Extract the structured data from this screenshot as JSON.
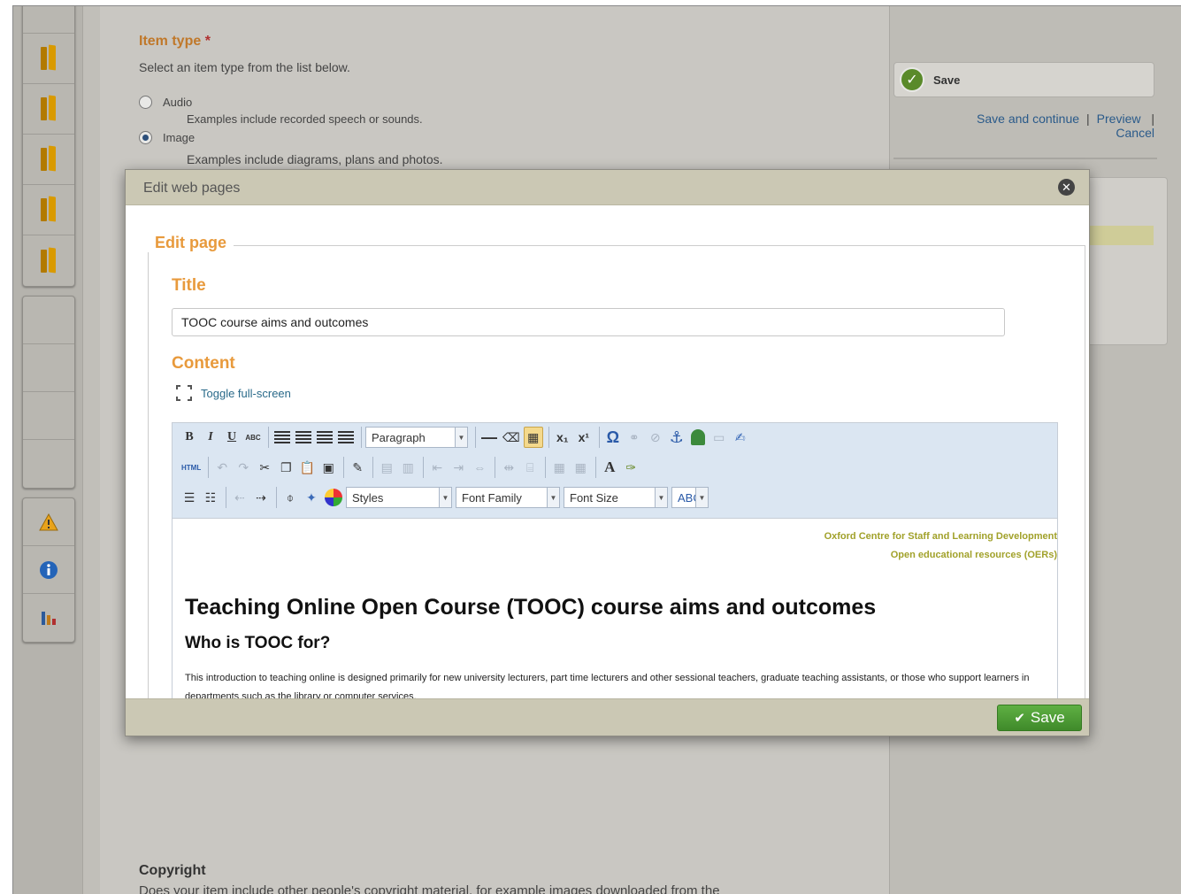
{
  "background": {
    "item_type_label": "Item type",
    "required_mark": "*",
    "item_type_hint": "Select an item type from the list below.",
    "options": [
      {
        "label": "Audio",
        "description": "Examples include recorded speech or sounds.",
        "checked": false
      },
      {
        "label": "Image",
        "description": "Examples include diagrams, plans and photos.",
        "checked": true
      }
    ],
    "copyright_label": "Copyright",
    "copyright_text": "Does your item include other people's copyright material, for example images downloaded from the"
  },
  "sidebar_icons": {
    "group1": [
      "book-icon",
      "book-icon",
      "book-icon",
      "book-icon",
      "book-icon"
    ],
    "group3": [
      "warning-icon",
      "info-icon",
      "chart-icon"
    ]
  },
  "right_panel": {
    "save_label": "Save",
    "save_and_continue": "Save and continue",
    "separator": "|",
    "preview": "Preview",
    "cancel": "Cancel"
  },
  "modal": {
    "title": "Edit web pages",
    "close_glyph": "✕",
    "legend": "Edit page",
    "title_label": "Title",
    "title_value": "TOOC course aims and outcomes",
    "content_label": "Content",
    "toggle_fullscreen": "Toggle full-screen",
    "save_button": "Save",
    "save_check": "✔"
  },
  "toolbar": {
    "format_select": "Paragraph",
    "styles_select": "Styles",
    "font_family_select": "Font Family",
    "font_size_select": "Font Size",
    "bold": "B",
    "italic": "I",
    "underline": "U",
    "strike": "ABC",
    "html": "HTML",
    "sub": "x₁",
    "sup": "x¹",
    "omega": "Ω",
    "text_color": "A"
  },
  "document": {
    "org_line1": "Oxford Centre for Staff and Learning Development",
    "org_line2": "Open educational resources (OERs)",
    "heading": "Teaching Online Open Course (TOOC) course aims and outcomes",
    "subheading": "Who is TOOC for?",
    "paragraph": "This introduction to teaching online is designed primarily for new university lecturers, part time lecturers and other sessional teachers, graduate teaching assistants, or those who support learners in departments such as the library or computer services."
  },
  "colors": {
    "accent_orange": "#e89a3c",
    "save_green": "#4a9b34",
    "link_blue": "#2a5a8a",
    "org_olive": "#a1a12a"
  }
}
